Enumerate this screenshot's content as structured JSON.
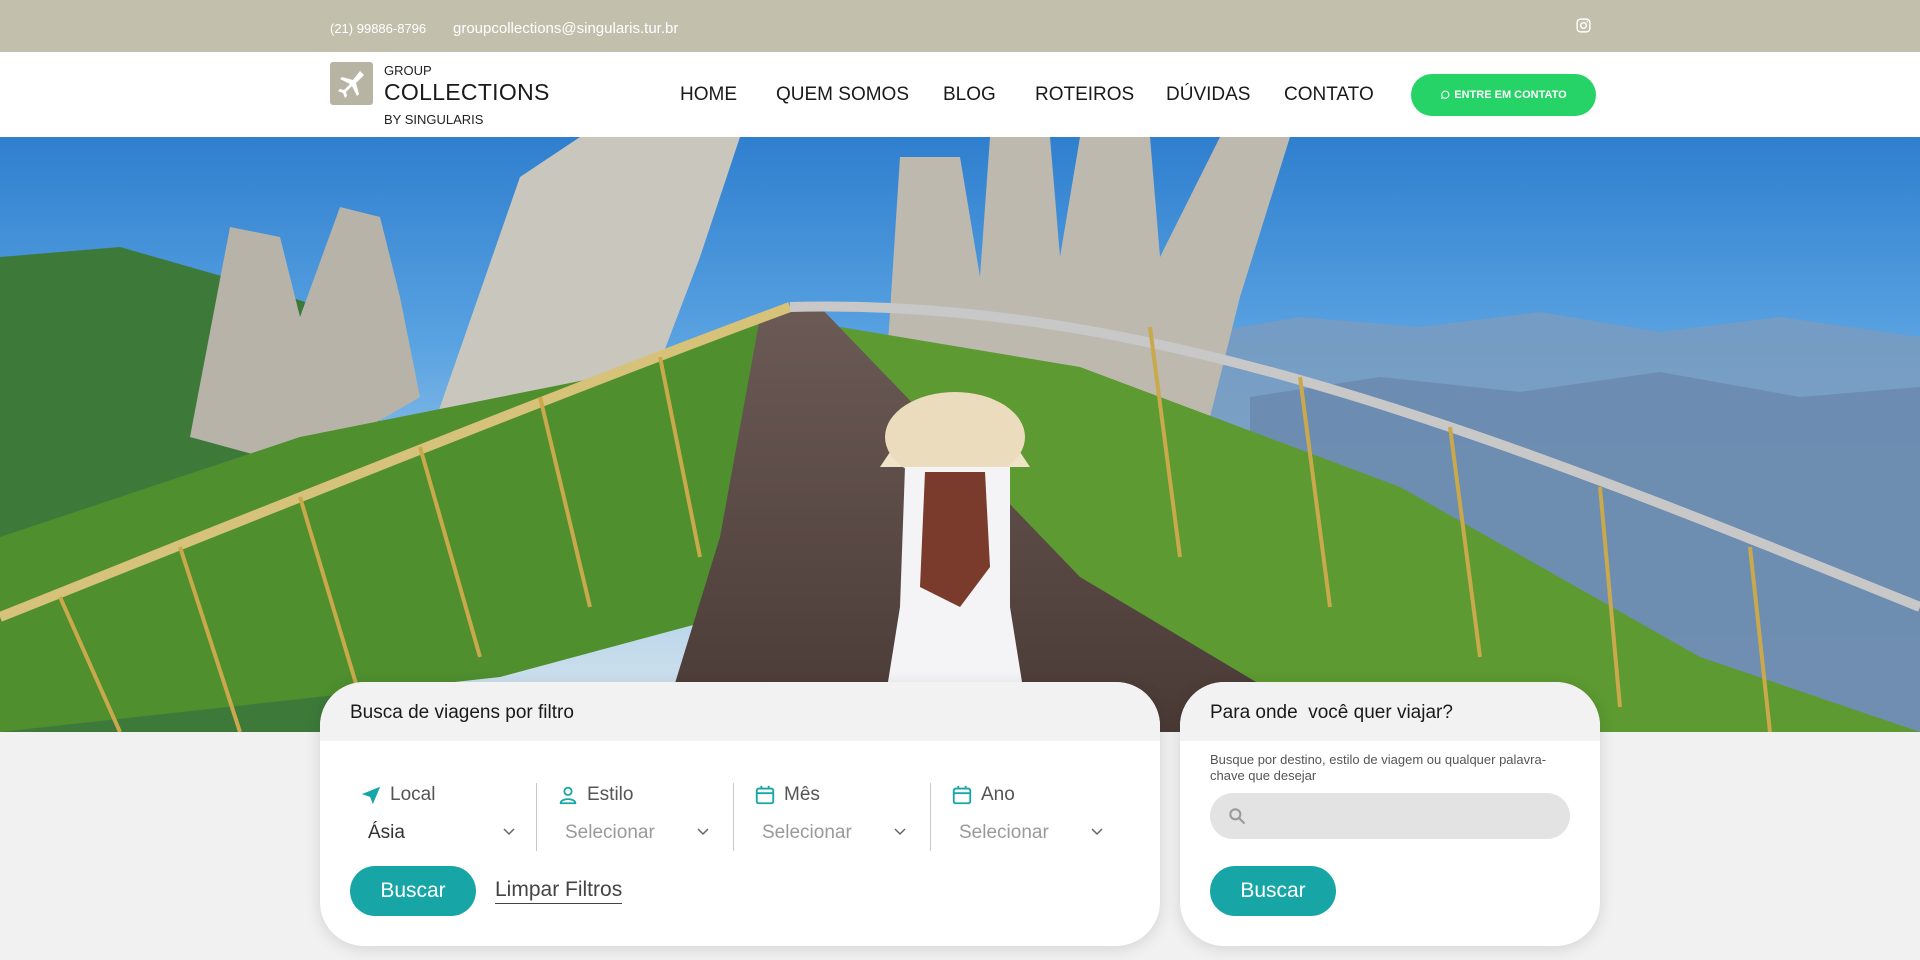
{
  "topbar": {
    "phone": "(21) 99886-8796",
    "email": "groupcollections@singularis.tur.br",
    "social_icon": "instagram-icon"
  },
  "logo": {
    "icon": "airplane-icon",
    "line1": "GROUP",
    "line2": "COLLECTIONS",
    "line3": "BY SINGULARIS"
  },
  "nav": {
    "items": [
      "HOME",
      "QUEM SOMOS",
      "BLOG",
      "ROTEIROS",
      "DÚVIDAS",
      "CONTATO"
    ]
  },
  "cta": {
    "label": "ENTRE EM CONTATO",
    "icon": "whatsapp-icon"
  },
  "filter": {
    "title": "Busca de viagens por filtro",
    "fields": [
      {
        "label": "Local",
        "value": "Ásia",
        "icon": "paper-plane-icon"
      },
      {
        "label": "Estilo",
        "value": "Selecionar",
        "icon": "user-icon"
      },
      {
        "label": "Mês",
        "value": "Selecionar",
        "icon": "calendar-icon"
      },
      {
        "label": "Ano",
        "value": "Selecionar",
        "icon": "calendar-icon"
      }
    ],
    "search_label": "Buscar",
    "clear_label": "Limpar Filtros"
  },
  "search": {
    "title": "Para onde  você quer viajar?",
    "description": "Busque por destino, estilo de viagem ou qualquer palavra-chave que desejar",
    "placeholder": "",
    "button_label": "Buscar"
  },
  "colors": {
    "topbar": "#c2bfad",
    "accent": "#17a5a5",
    "whatsapp": "#25d366"
  }
}
